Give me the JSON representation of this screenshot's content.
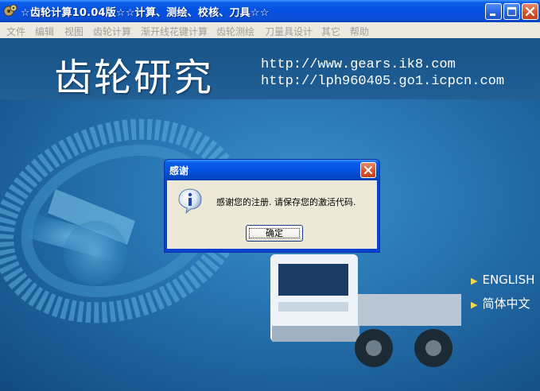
{
  "window": {
    "title": "☆齿轮计算10.04版☆☆计算、测绘、校核、刀具☆☆",
    "controls": {
      "minimize": "minimize",
      "maximize": "maximize",
      "close": "close"
    }
  },
  "menu": {
    "items": [
      {
        "label": "文件"
      },
      {
        "label": "编辑"
      },
      {
        "label": "视图"
      },
      {
        "label": "齿轮计算"
      },
      {
        "label": "渐开线花键计算"
      },
      {
        "label": "齿轮测绘"
      },
      {
        "label": "刀量具设计"
      },
      {
        "label": "其它"
      },
      {
        "label": "帮助"
      }
    ]
  },
  "banner": {
    "title": "齿轮研究",
    "urls": [
      "http://www.gears.ik8.com",
      "http://lph960405.go1.icpcn.com"
    ]
  },
  "language_links": [
    {
      "label": "ENGLISH"
    },
    {
      "label": "简体中文"
    }
  ],
  "dialog": {
    "title": "感谢",
    "message": "感谢您的注册. 请保存您的激活代码.",
    "ok_label": "确定",
    "icon": "info-icon"
  },
  "colors": {
    "titlebar": "#0450e0",
    "menubar": "#eceae0",
    "menu_text_disabled": "#a19f96",
    "background": "#1c5f98",
    "dialog_body": "#ece9d8",
    "accent_arrow": "#f6d84a"
  }
}
